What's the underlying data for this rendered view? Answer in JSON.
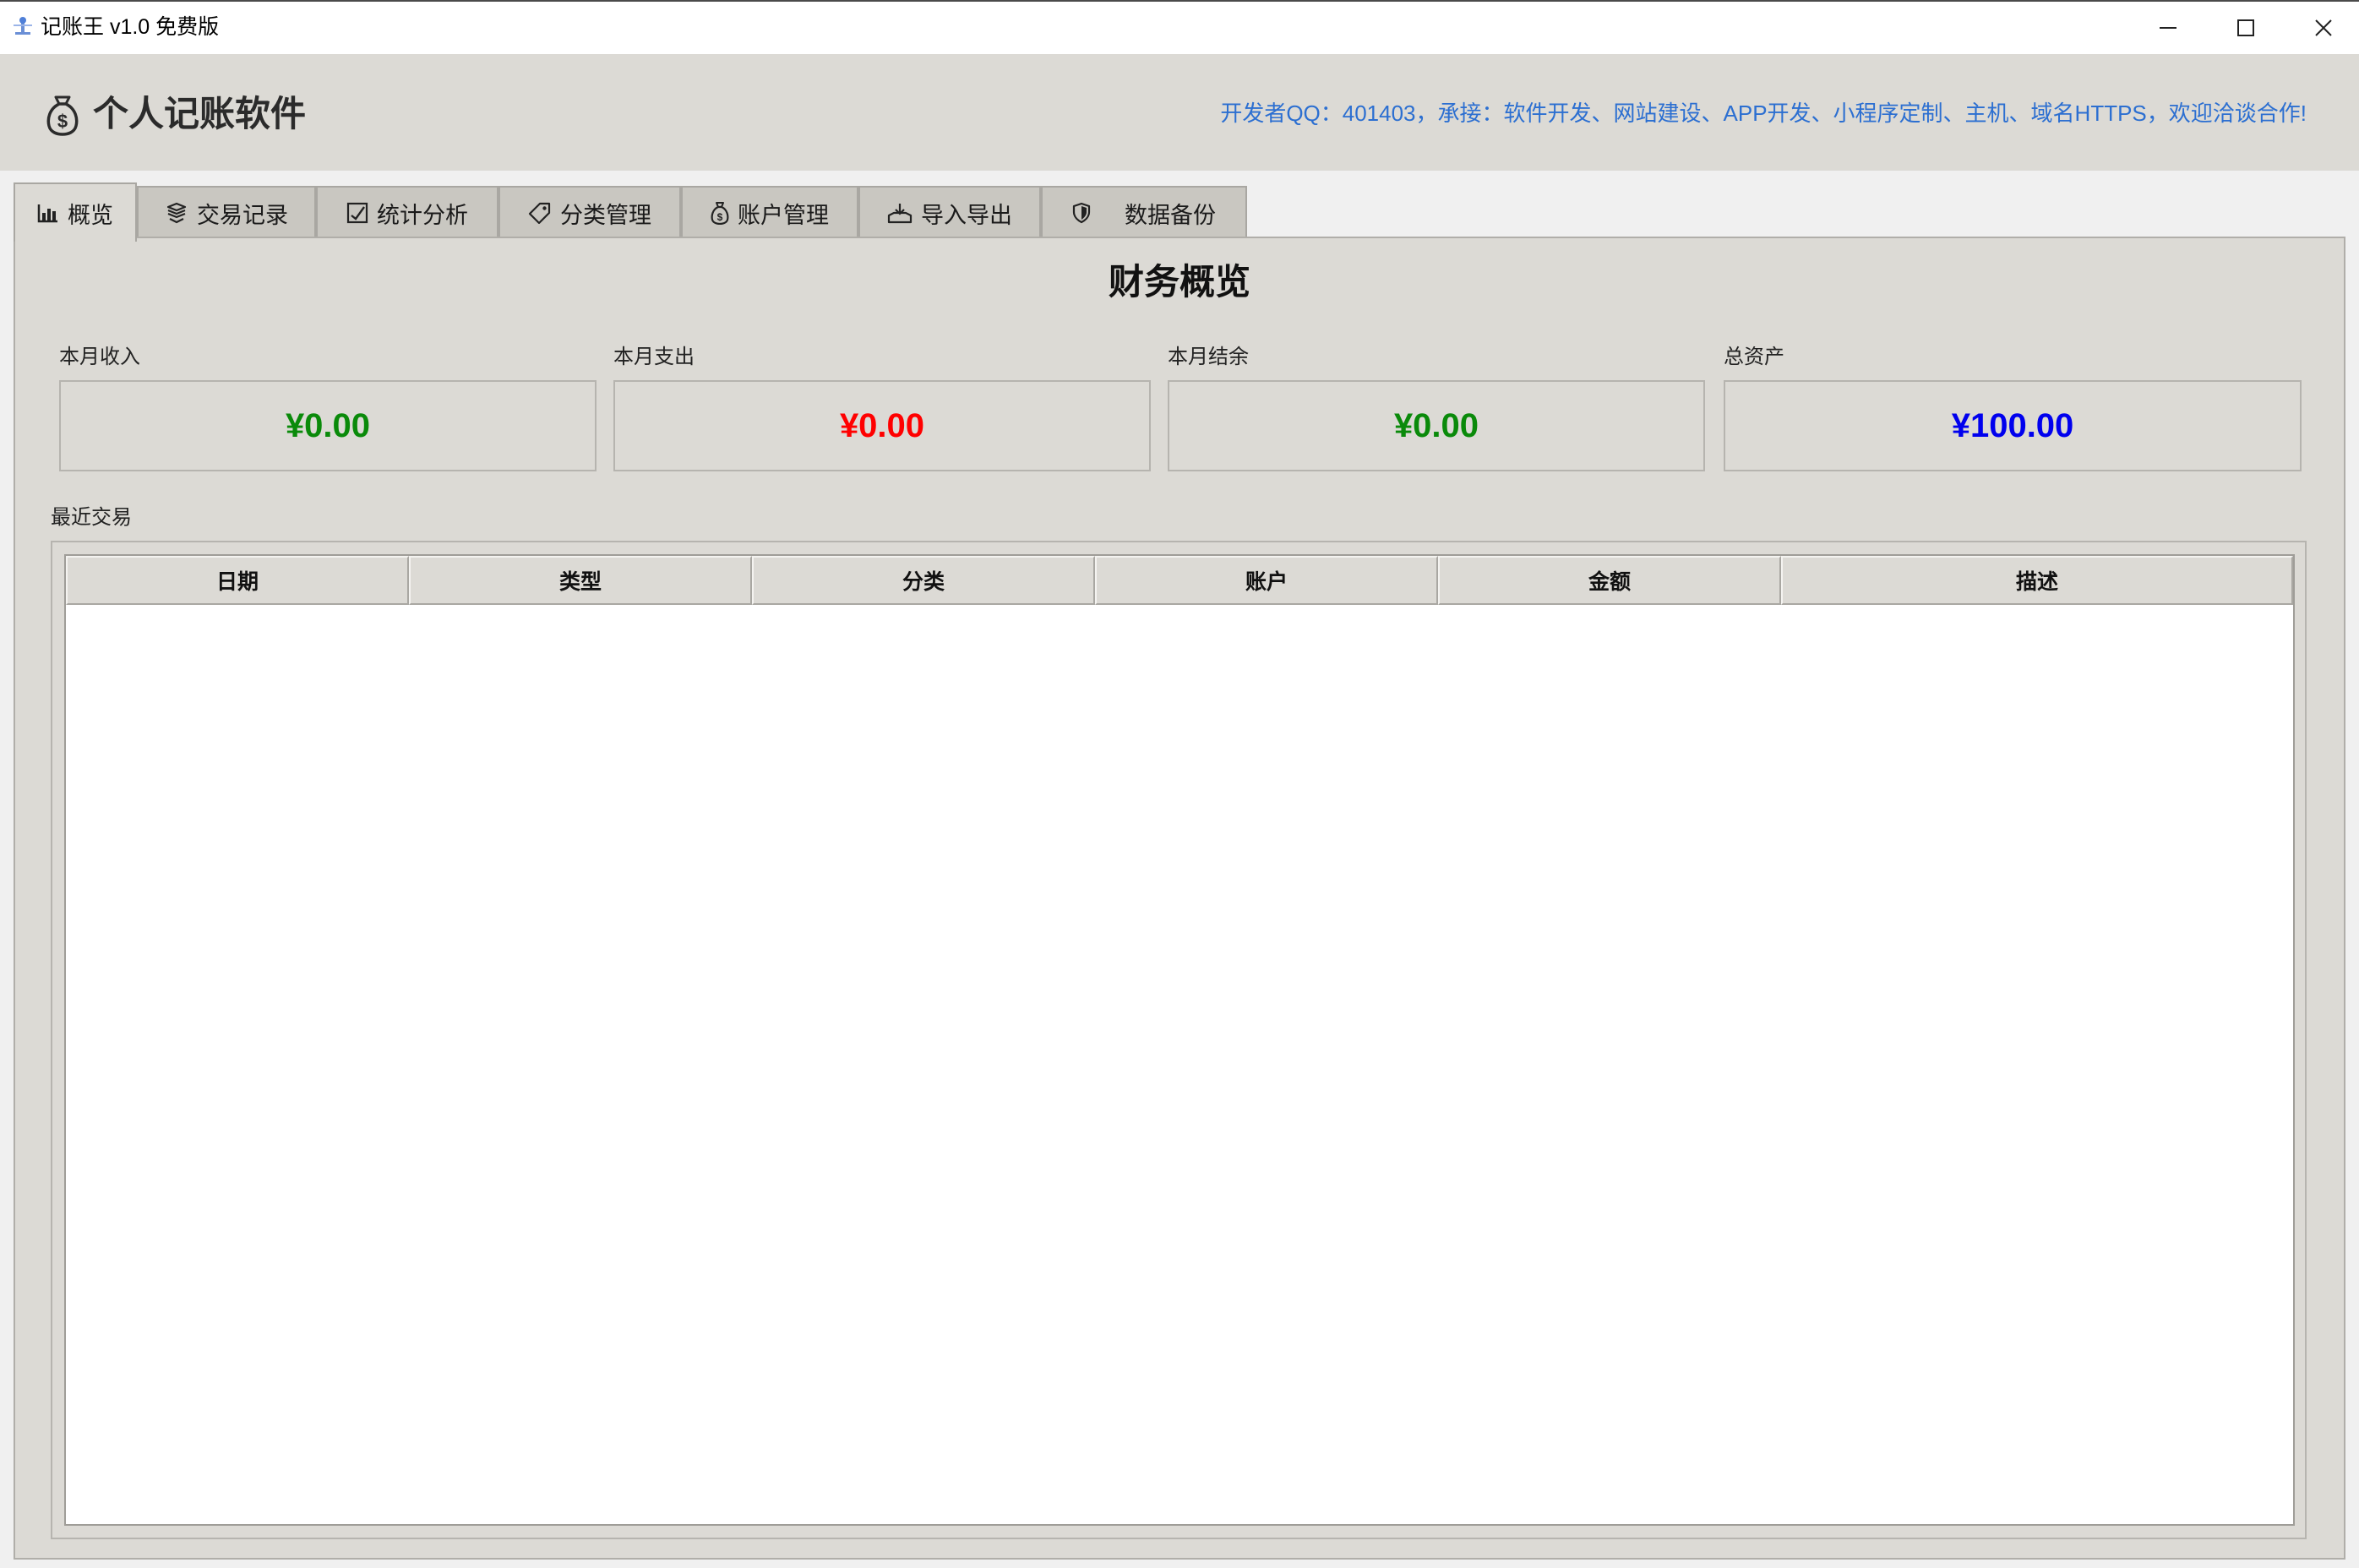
{
  "window": {
    "title": "记账王 v1.0 免费版",
    "icon": "app-icon"
  },
  "header": {
    "app_name": "个人记账软件",
    "dev_info": "开发者QQ：401403，承接：软件开发、网站建设、APP开发、小程序定制、主机、域名HTTPS，欢迎洽谈合作!",
    "dev_info_color": "#2c6fd1"
  },
  "tabs": [
    {
      "label": "概览",
      "icon": "bar-chart-icon",
      "active": true
    },
    {
      "label": "交易记录",
      "icon": "exchange-icon",
      "active": false
    },
    {
      "label": "统计分析",
      "icon": "chart-check-icon",
      "active": false
    },
    {
      "label": "分类管理",
      "icon": "tag-icon",
      "active": false
    },
    {
      "label": "账户管理",
      "icon": "money-bag-icon",
      "active": false
    },
    {
      "label": "导入导出",
      "icon": "import-export-icon",
      "active": false
    },
    {
      "label": "数据备份",
      "icon": "shield-icon",
      "active": false
    }
  ],
  "overview": {
    "title": "财务概览",
    "cards": [
      {
        "label": "本月收入",
        "value": "¥0.00",
        "color": "#0a8a0a"
      },
      {
        "label": "本月支出",
        "value": "¥0.00",
        "color": "#ff0000"
      },
      {
        "label": "本月结余",
        "value": "¥0.00",
        "color": "#0a8a0a"
      },
      {
        "label": "总资产",
        "value": "¥100.00",
        "color": "#0000ee"
      }
    ],
    "recent_label": "最近交易",
    "table": {
      "columns": [
        "日期",
        "类型",
        "分类",
        "账户",
        "金额",
        "描述"
      ],
      "rows": []
    }
  }
}
